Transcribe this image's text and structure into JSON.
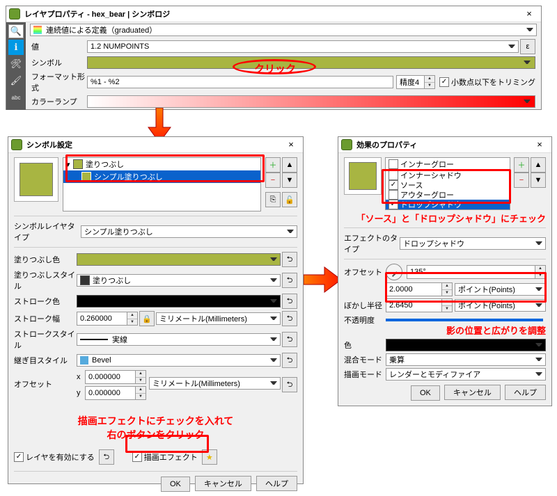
{
  "top": {
    "title": "レイヤプロパティ - hex_bear | シンボロジ",
    "renderer": "連続値による定義（graduated）",
    "value_lbl": "値",
    "value": "1.2 NUMPOINTS",
    "epsilon_btn": "ε",
    "symbol_lbl": "シンボル",
    "format_lbl": "フォーマット形式",
    "format": "%1 - %2",
    "precision_lbl": "精度4",
    "trim_lbl": "小数点以下をトリミング",
    "ramp_lbl": "カラーランプ",
    "click_ann": "クリック"
  },
  "sym": {
    "title": "シンボル設定",
    "tree_root": "塗りつぶし",
    "tree_child": "シンプル塗りつぶし",
    "layertype_lbl": "シンボルレイヤタイプ",
    "layertype": "シンプル塗りつぶし",
    "fillcolor_lbl": "塗りつぶし色",
    "fillstyle_lbl": "塗りつぶしスタイル",
    "fillstyle": "塗りつぶし",
    "strokecolor_lbl": "ストローク色",
    "strokewidth_lbl": "ストローク幅",
    "strokewidth": "0.260000",
    "mm": "ミリメートル(Millimeters)",
    "strokestyle_lbl": "ストロークスタイル",
    "strokestyle": "実線",
    "joinstyle_lbl": "継ぎ目スタイル",
    "joinstyle": "Bevel",
    "offset_lbl": "オフセット",
    "offset_x": "0.000000",
    "offset_y": "0.000000",
    "x_lbl": "x",
    "y_lbl": "y",
    "enable_layer": "レイヤを有効にする",
    "draw_effect": "描画エフェクト",
    "ann1": "描画エフェクトにチェックを入れて",
    "ann2": "右のボタンをクリック",
    "ok": "OK",
    "cancel": "キャンセル",
    "help": "ヘルプ"
  },
  "eff": {
    "title": "効果のプロパティ",
    "items": [
      "インナーグロー",
      "インナーシャドウ",
      "ソース",
      "アウターグロー",
      "ドロップシャドウ"
    ],
    "checked": [
      false,
      false,
      true,
      false,
      true
    ],
    "ann_check": "「ソース」と「ドロップシャドウ」にチェック",
    "type_lbl": "エフェクトのタイプ",
    "type": "ドロップシャドウ",
    "offset_lbl": "オフセット",
    "offset_ang": "135°",
    "offset_dist": "2.0000",
    "points": "ポイント(Points)",
    "blur_lbl": "ぼかし半径",
    "blur": "2.6450",
    "opacity_lbl": "不透明度",
    "ann_adjust": "影の位置と広がりを調整",
    "color_lbl": "色",
    "blend_lbl": "混合モード",
    "blend": "乗算",
    "drawmode_lbl": "描画モード",
    "drawmode": "レンダーとモディファイア",
    "ok": "OK",
    "cancel": "キャンセル",
    "help": "ヘルプ"
  }
}
